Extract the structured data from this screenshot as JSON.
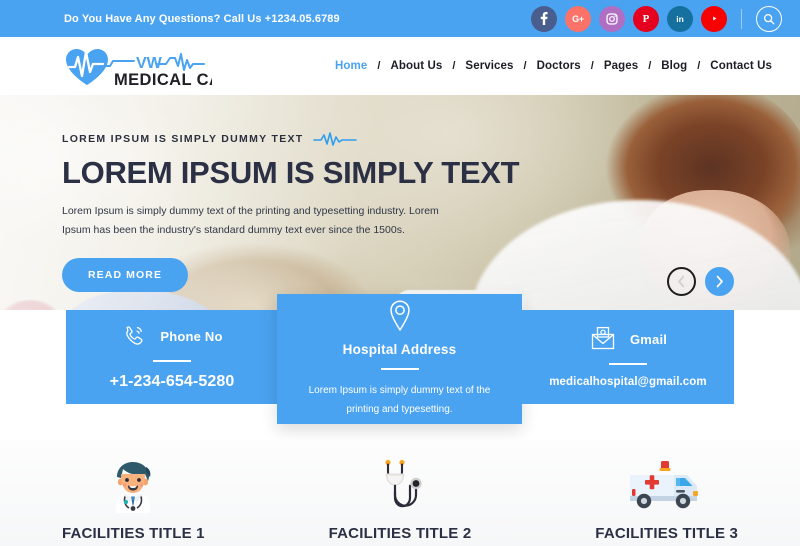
{
  "topbar": {
    "text": "Do You Have Any Questions? Call Us +1234.05.6789",
    "social": [
      {
        "name": "facebook",
        "glyph": "f",
        "color": "#4a5d8f"
      },
      {
        "name": "google-plus",
        "glyph": "G+",
        "color": "#fa7268"
      },
      {
        "name": "instagram",
        "glyph": "▣",
        "color": "#b06ec2"
      },
      {
        "name": "pinterest",
        "glyph": "P",
        "color": "#e6001f"
      },
      {
        "name": "linkedin",
        "glyph": "in",
        "color": "#1570a0"
      },
      {
        "name": "youtube",
        "glyph": "▶",
        "color": "#f90000"
      }
    ],
    "search_icon": "search-icon"
  },
  "brand": {
    "name_top": "VW",
    "name_bottom": "MEDICAL CARE",
    "logo_icon": "heart-pulse-logo",
    "color": "#4aa3f0"
  },
  "nav": {
    "separator": "/",
    "items": [
      {
        "label": "Home",
        "active": true
      },
      {
        "label": "About Us",
        "active": false
      },
      {
        "label": "Services",
        "active": false
      },
      {
        "label": "Doctors",
        "active": false
      },
      {
        "label": "Pages",
        "active": false
      },
      {
        "label": "Blog",
        "active": false
      },
      {
        "label": "Contact Us",
        "active": false
      }
    ]
  },
  "hero": {
    "eyebrow": "LOREM IPSUM IS SIMPLY DUMMY TEXT",
    "title": "LOREM IPSUM IS SIMPLY TEXT",
    "description": "Lorem Ipsum is simply dummy text of the printing and typesetting industry. Lorem Ipsum has been the industry's standard dummy text ever since the 1500s.",
    "button_label": "READ MORE",
    "prev_icon": "chevron-left-icon",
    "next_icon": "chevron-right-icon"
  },
  "cards": {
    "phone": {
      "icon": "phone-ringing-icon",
      "title": "Phone No",
      "value": "+1-234-654-5280"
    },
    "address": {
      "icon": "map-pin-icon",
      "title": "Hospital Address",
      "text": "Lorem Ipsum is simply dummy text of the printing and typesetting."
    },
    "gmail": {
      "icon": "envelope-at-icon",
      "title": "Gmail",
      "value": "medicalhospital@gmail.com"
    },
    "background": "#4aa3f0"
  },
  "facilities": [
    {
      "label": "FACILITIES TITLE 1",
      "icon": "doctor-avatar-icon"
    },
    {
      "label": "FACILITIES TITLE 2",
      "icon": "stethoscope-icon"
    },
    {
      "label": "FACILITIES TITLE 3",
      "icon": "ambulance-icon"
    }
  ]
}
